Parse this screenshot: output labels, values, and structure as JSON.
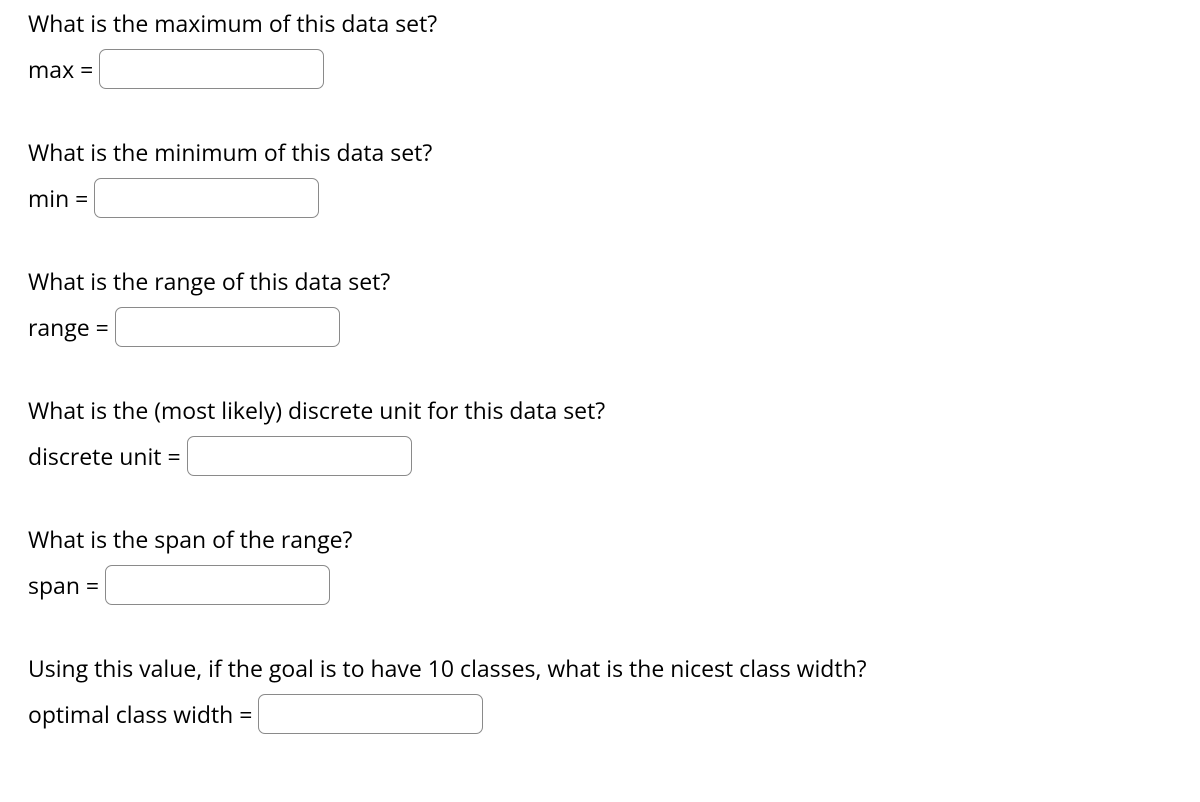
{
  "questions": [
    {
      "prompt": "What is the maximum of this data set?",
      "label": "max = ",
      "value": ""
    },
    {
      "prompt": "What is the minimum of this data set?",
      "label": "min = ",
      "value": ""
    },
    {
      "prompt": "What is the range of this data set?",
      "label": "range = ",
      "value": ""
    },
    {
      "prompt": "What is the (most likely) discrete unit for this data set?",
      "label": "discrete unit = ",
      "value": ""
    },
    {
      "prompt": "What is the span of the range?",
      "label": "span = ",
      "value": ""
    },
    {
      "prompt": "Using this value, if the goal is to have 10 classes, what is the nicest class width?",
      "label": "optimal class width = ",
      "value": ""
    }
  ]
}
